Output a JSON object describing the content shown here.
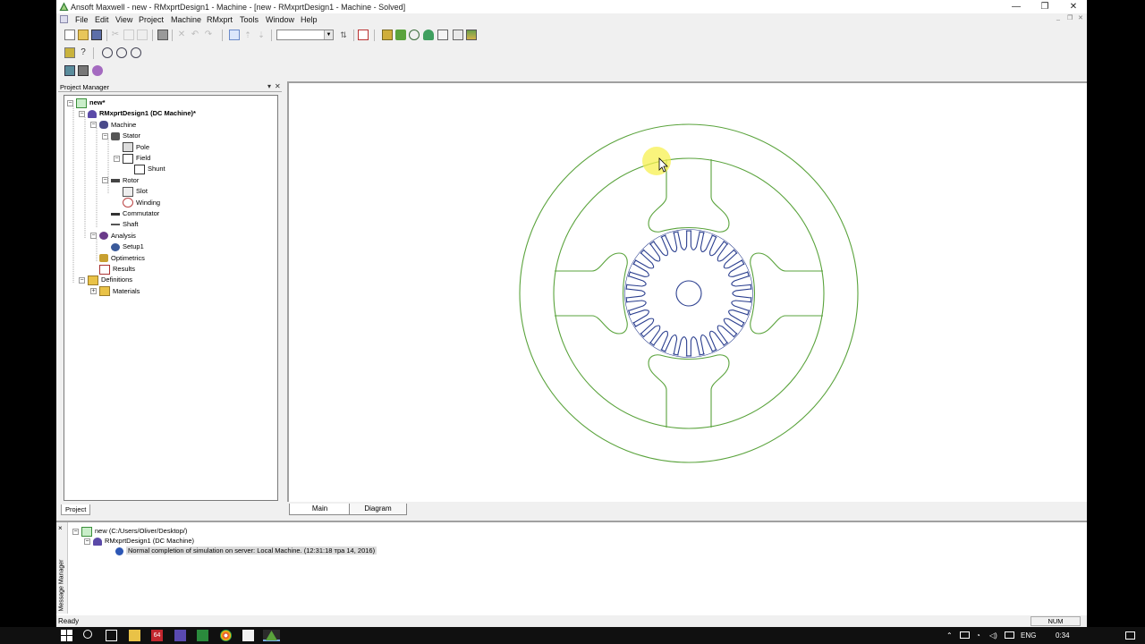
{
  "window": {
    "title": "Ansoft Maxwell - new - RMxprtDesign1 - Machine - [new - RMxprtDesign1 - Machine - Solved]",
    "controls": [
      "—",
      "❐",
      "✕"
    ],
    "mdi_controls": [
      "_",
      "❐",
      "✕"
    ]
  },
  "menu": [
    "File",
    "Edit",
    "View",
    "Project",
    "Machine",
    "RMxprt",
    "Tools",
    "Window",
    "Help"
  ],
  "project_manager": {
    "title": "Project Manager",
    "header_controls": [
      "▾",
      "✕"
    ],
    "tree": [
      {
        "label": "new*",
        "bold": true,
        "exp": "−",
        "icon": "project-icon"
      },
      {
        "label": "RMxprtDesign1 (DC Machine)*",
        "bold": true,
        "exp": "−",
        "icon": "design-icon"
      },
      {
        "label": "Machine",
        "exp": "−",
        "icon": "machine-icon"
      },
      {
        "label": "Stator",
        "exp": "−",
        "icon": "stator-icon"
      },
      {
        "label": "Pole",
        "exp": "",
        "icon": "pole-icon"
      },
      {
        "label": "Field",
        "exp": "−",
        "icon": "field-icon"
      },
      {
        "label": "Shunt",
        "exp": "",
        "icon": "shunt-icon"
      },
      {
        "label": "Rotor",
        "exp": "−",
        "icon": "rotor-icon"
      },
      {
        "label": "Slot",
        "exp": "",
        "icon": "slot-icon"
      },
      {
        "label": "Winding",
        "exp": "",
        "icon": "winding-icon"
      },
      {
        "label": "Commutator",
        "exp": "",
        "icon": "commutator-icon"
      },
      {
        "label": "Shaft",
        "exp": "",
        "icon": "shaft-icon"
      },
      {
        "label": "Analysis",
        "exp": "−",
        "icon": "analysis-icon"
      },
      {
        "label": "Setup1",
        "exp": "",
        "icon": "setup-icon"
      },
      {
        "label": "Optimetrics",
        "exp": "",
        "icon": "optimetrics-icon"
      },
      {
        "label": "Results",
        "exp": "",
        "icon": "results-icon"
      },
      {
        "label": "Definitions",
        "exp": "−",
        "icon": "folder-icon"
      },
      {
        "label": "Materials",
        "exp": "+",
        "icon": "folder-icon"
      }
    ],
    "tab": "Project"
  },
  "canvas_tabs": [
    "Main",
    "Diagram"
  ],
  "message_manager": {
    "side_title": "Message Manager",
    "close": "×",
    "rows": [
      {
        "text": "new (C:/Users/Oliver/Desktop/)"
      },
      {
        "text": "RMxprtDesign1 (DC Machine)"
      },
      {
        "text": "Normal completion of simulation on server: Local Machine. (12:31:18  тра 14, 2016)"
      }
    ]
  },
  "status": {
    "text": "Ready",
    "num": "NUM"
  },
  "taskbar": {
    "lang": "ENG",
    "time": "0:34",
    "badge": "64"
  },
  "colors": {
    "stator_green": "#5aa33c",
    "rotor_blue": "#2b3f8f",
    "cursor_highlight": "#f7f050"
  }
}
